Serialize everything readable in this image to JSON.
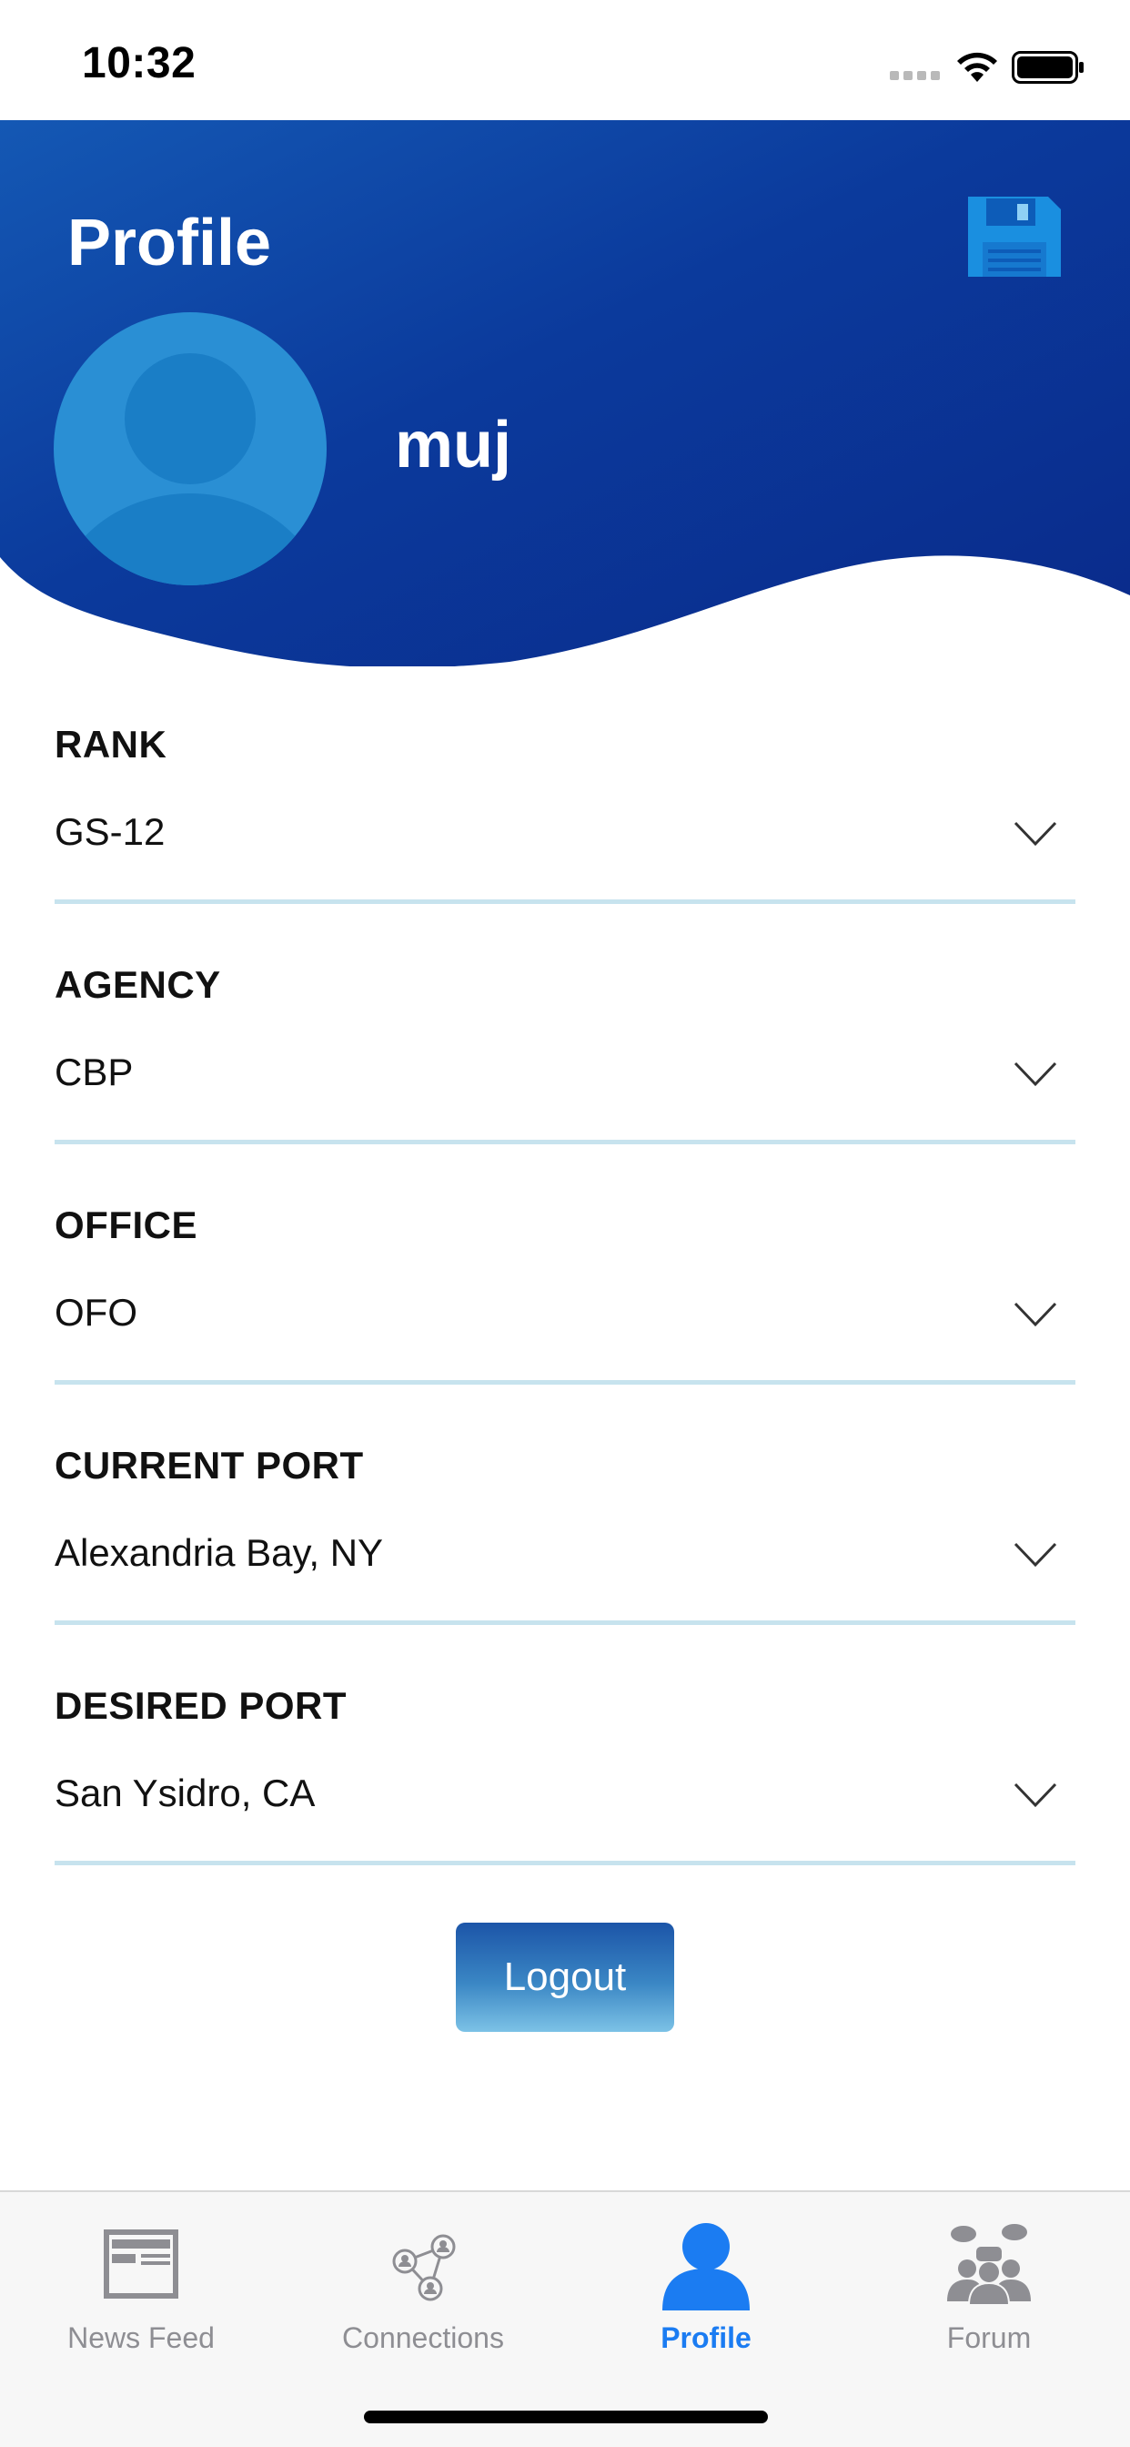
{
  "status_bar": {
    "time": "10:32"
  },
  "header": {
    "title": "Profile",
    "username": "muj",
    "colors": {
      "gradient_start": "#1458b4",
      "gradient_end": "#0a2a8a",
      "avatar": "#2a8fd4"
    },
    "icons": {
      "save": "floppy-disk-icon",
      "avatar": "user-avatar-icon"
    }
  },
  "fields": [
    {
      "label": "RANK",
      "value": "GS-12"
    },
    {
      "label": "AGENCY",
      "value": "CBP"
    },
    {
      "label": "OFFICE",
      "value": "OFO"
    },
    {
      "label": "CURRENT PORT",
      "value": "Alexandria Bay, NY"
    },
    {
      "label": "DESIRED PORT",
      "value": "San Ysidro, CA"
    }
  ],
  "logout": {
    "label": "Logout"
  },
  "tabs": [
    {
      "label": "News Feed",
      "icon": "newspaper-icon",
      "active": false
    },
    {
      "label": "Connections",
      "icon": "network-icon",
      "active": false
    },
    {
      "label": "Profile",
      "icon": "person-icon",
      "active": true
    },
    {
      "label": "Forum",
      "icon": "group-chat-icon",
      "active": false
    }
  ],
  "colors": {
    "active_tab": "#1b7cf2",
    "inactive_tab": "#8e8e93",
    "field_line": "#c7e3ee"
  }
}
